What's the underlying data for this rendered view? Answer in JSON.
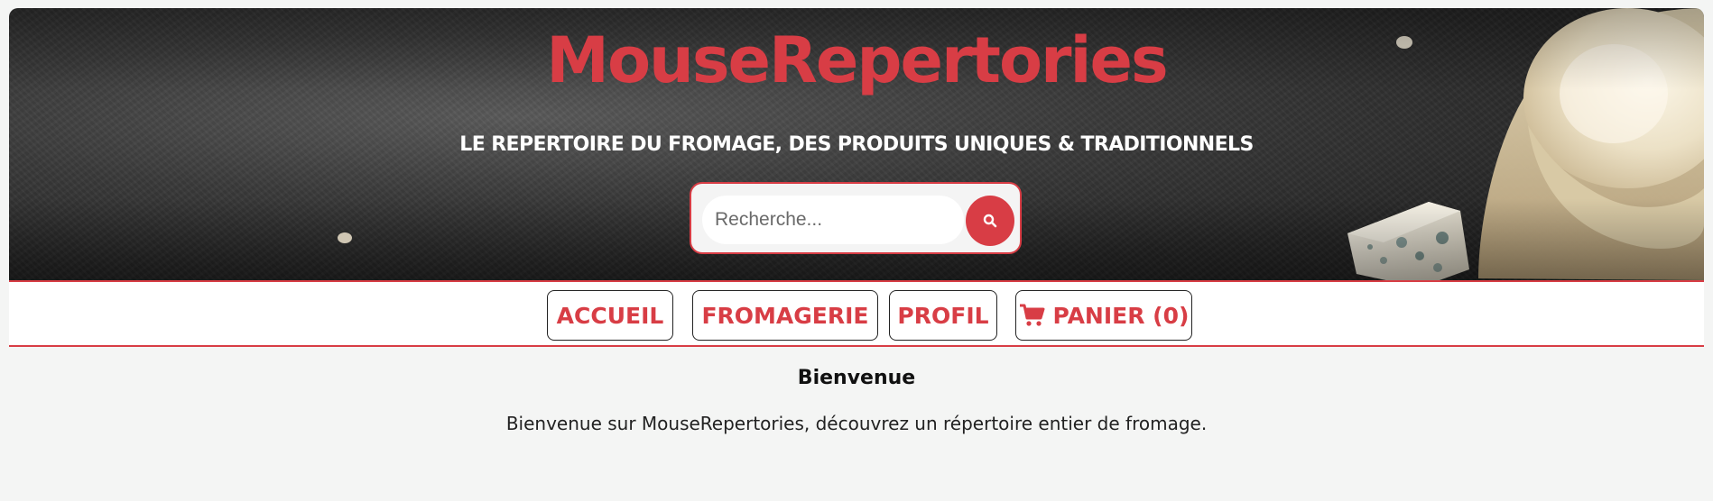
{
  "header": {
    "brand": "MouseRepertories",
    "tagline": "LE REPERTOIRE DU FROMAGE, DES PRODUITS UNIQUES & TRADITIONNELS"
  },
  "search": {
    "placeholder": "Recherche...",
    "value": "",
    "button_icon": "search-icon"
  },
  "nav": {
    "items": [
      {
        "label": "ACCUEIL"
      },
      {
        "label": "FROMAGERIE"
      },
      {
        "label": "PROFIL"
      },
      {
        "label": "PANIER (0)",
        "icon": "cart-icon"
      }
    ]
  },
  "main": {
    "title": "Bienvenue",
    "text": "Bienvenue sur MouseRepertories, découvrez un répertoire entier de fromage."
  },
  "colors": {
    "accent": "#d83d45",
    "background": "#f4f5f4"
  }
}
